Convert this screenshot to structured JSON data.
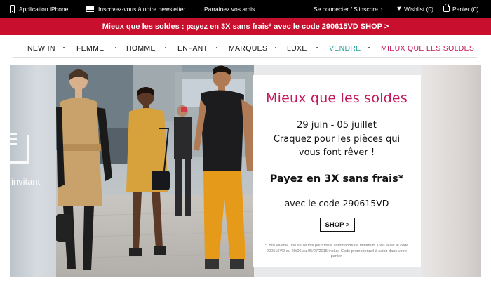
{
  "topbar": {
    "app_label": "Application iPhone",
    "newsletter_label": "Inscrivez-vous à notre newsletter",
    "referral_label": "Parrainez vos amis",
    "login_label": "Se connecter / S'inscrire",
    "login_chevron": "›",
    "wishlist_label": "Wishlist (0)",
    "cart_label": "Panier (0)",
    "heart_glyph": "♥"
  },
  "promo_banner": {
    "text": "Mieux que les soldes : payez en 3X sans frais* avec le code 290615VD SHOP >"
  },
  "nav": {
    "items": [
      {
        "label": "NEW IN"
      },
      {
        "label": "FEMME"
      },
      {
        "label": "HOMME"
      },
      {
        "label": "ENFANT"
      },
      {
        "label": "MARQUES"
      },
      {
        "label": "LUXE"
      },
      {
        "label": "VENDRE"
      },
      {
        "label": "MIEUX QUE LES SOLDES"
      }
    ],
    "colors": {
      "default": "#111111",
      "vendre": "#2aa39a",
      "highlight": "#c2185b"
    }
  },
  "hero": {
    "left_partial_text": "invitant",
    "card": {
      "title": "Mieux que les soldes",
      "dates": "29 juin - 05 juillet",
      "line1": "Craquez pour les pièces qui",
      "line2": "vous font rêver !",
      "payment": "Payez en 3X sans frais*",
      "code_line": "avec le code 290615VD",
      "shop_button": "SHOP >",
      "fine_print": "*Offre valable une seule fois pour toute commande de minimum 150€ avec le code 290615VD du 29/06 au 05/07/2015 inclus. Code promotionnel à saisir dans votre panier."
    }
  },
  "colors": {
    "topbar_bg": "#000000",
    "promo_bg": "#c8102e",
    "accent_pink": "#c2185b",
    "accent_teal": "#2aa39a"
  }
}
